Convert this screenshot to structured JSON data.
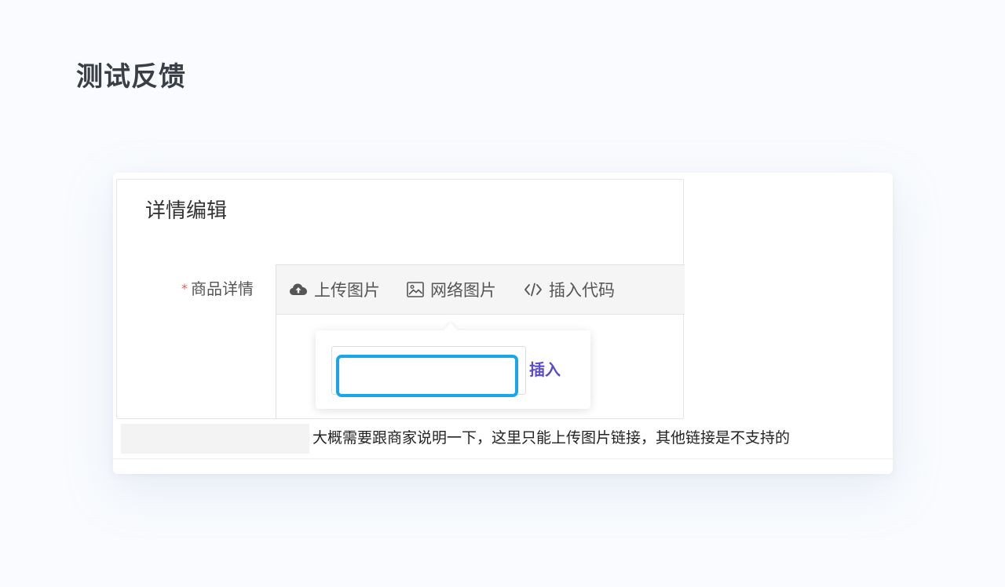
{
  "page": {
    "title": "测试反馈"
  },
  "editor": {
    "panel_title": "详情编辑",
    "field": {
      "required_mark": "*",
      "label": "商品详情"
    },
    "toolbar": {
      "upload_label": "上传图片",
      "network_image_label": "网络图片",
      "insert_code_label": "插入代码"
    },
    "popover": {
      "url_value": "",
      "insert_label": "插入"
    }
  },
  "feedback": {
    "note": "大概需要跟商家说明一下，这里只能上传图片链接，其他链接是不支持的"
  },
  "colors": {
    "accent_focus": "#1aa7ea",
    "insert_link": "#5a4ccf",
    "required": "#e05d5d",
    "background": "#f9fbfe"
  }
}
